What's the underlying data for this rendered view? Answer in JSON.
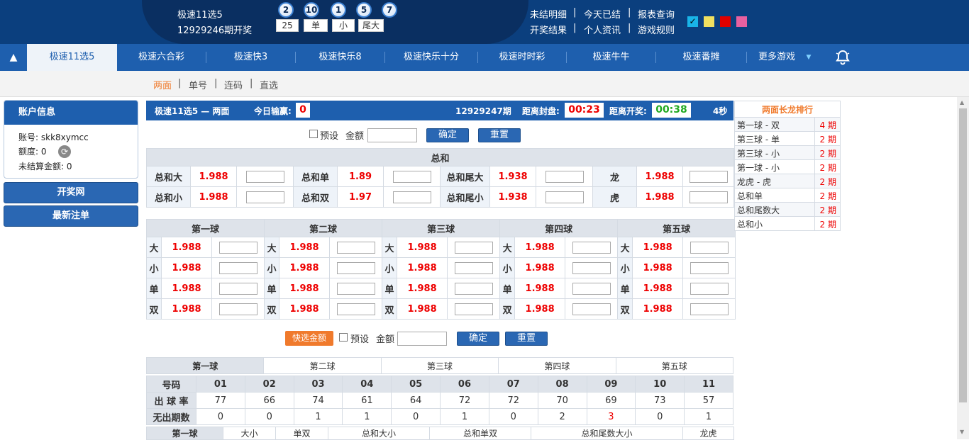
{
  "header": {
    "lottery": "极速11选5",
    "issue_open": "12929246期开奖",
    "balls": [
      "2",
      "10",
      "1",
      "5",
      "7"
    ],
    "tags": [
      "25",
      "单",
      "小",
      "尾大"
    ],
    "links_row1": [
      "未结明细",
      "今天已结",
      "报表查询"
    ],
    "links_row2": [
      "开奖结果",
      "个人资讯",
      "游戏规则"
    ],
    "sep": "|",
    "swatch_colors": [
      "#19b4e8",
      "#f0e060",
      "#e00000",
      "#e860a0"
    ],
    "check_mark": "✓"
  },
  "nav": {
    "toggle": "▲",
    "items": [
      "极速11选5",
      "极速六合彩",
      "极速快3",
      "极速快乐8",
      "极速快乐十分",
      "极速时时彩",
      "极速牛牛",
      "极速番摊",
      "更多游戏"
    ],
    "more_arrow": "▼",
    "bell": "bell-icon"
  },
  "subnav": {
    "items": [
      "两面",
      "单号",
      "连码",
      "直选"
    ],
    "sep": "|"
  },
  "account": {
    "title": "账户信息",
    "account_label": "账号:",
    "account_value": "skk8xymcc",
    "limit_label": "额度:",
    "limit_value": "0",
    "unsettled_label": "未结算金额:",
    "unsettled_value": "0"
  },
  "sidebar_buttons": [
    "开奖网",
    "最新注单"
  ],
  "infobar": {
    "title": "极速11选5 — 两面",
    "today_label": "今日输赢:",
    "today_value": "0",
    "issue": "12929247期",
    "close_label": "距离封盘:",
    "close_value": "00:23",
    "open_label": "距离开奖:",
    "open_value": "00:38",
    "seconds": "4秒"
  },
  "quickbet": {
    "preset": "预设",
    "amount": "金额",
    "confirm": "确定",
    "reset": "重置",
    "quickfill": "快选金额"
  },
  "sum_table": {
    "title": "总和",
    "rows": [
      [
        [
          "总和大",
          "1.988"
        ],
        [
          "总和单",
          "1.89"
        ],
        [
          "总和尾大",
          "1.938"
        ],
        [
          "龙",
          "1.988"
        ]
      ],
      [
        [
          "总和小",
          "1.988"
        ],
        [
          "总和双",
          "1.97"
        ],
        [
          "总和尾小",
          "1.938"
        ],
        [
          "虎",
          "1.988"
        ]
      ]
    ]
  },
  "ball_table": {
    "headers": [
      "第一球",
      "第二球",
      "第三球",
      "第四球",
      "第五球"
    ],
    "row_labels": [
      "大",
      "小",
      "单",
      "双"
    ],
    "odds": "1.988"
  },
  "stat_tabs": [
    "第一球",
    "第二球",
    "第三球",
    "第四球",
    "第五球"
  ],
  "stats": {
    "row_headers": [
      "号码",
      "出 球 率",
      "无出期数"
    ],
    "numbers": [
      "01",
      "02",
      "03",
      "04",
      "05",
      "06",
      "07",
      "08",
      "09",
      "10",
      "11"
    ],
    "rate": [
      "77",
      "66",
      "74",
      "61",
      "64",
      "72",
      "72",
      "70",
      "69",
      "73",
      "57"
    ],
    "missing": [
      "0",
      "0",
      "1",
      "1",
      "0",
      "1",
      "0",
      "2",
      "3",
      "0",
      "1"
    ]
  },
  "bottom_tabs": [
    "第一球",
    "大小",
    "单双",
    "总和大小",
    "总和单双",
    "总和尾数大小",
    "龙虎"
  ],
  "ranking": {
    "title": "两面长龙排行",
    "rows": [
      [
        "第一球 - 双",
        "4 期"
      ],
      [
        "第三球 - 单",
        "2 期"
      ],
      [
        "第三球 - 小",
        "2 期"
      ],
      [
        "第一球 - 小",
        "2 期"
      ],
      [
        "龙虎 - 虎",
        "2 期"
      ],
      [
        "总和单",
        "2 期"
      ],
      [
        "总和尾数大",
        "2 期"
      ],
      [
        "总和小",
        "2 期"
      ]
    ]
  }
}
